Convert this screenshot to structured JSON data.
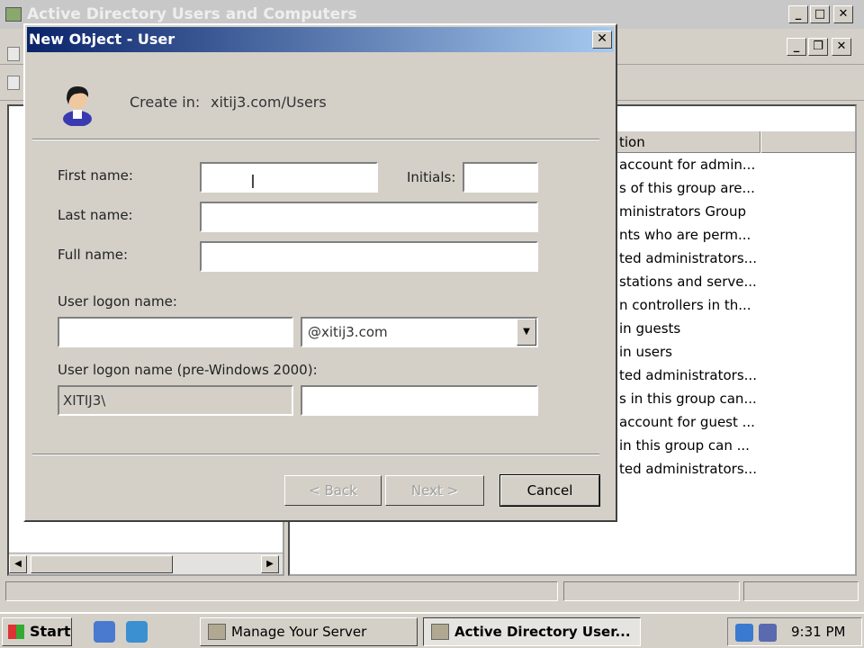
{
  "main_window": {
    "title": "Active Directory Users and Computers",
    "list": {
      "column_header": "tion",
      "rows": [
        "account for admin...",
        "s of this group are...",
        "ministrators Group",
        "nts who are perm...",
        "ted administrators...",
        "stations and serve...",
        "n controllers in th...",
        "in guests",
        "in users",
        "ted administrators...",
        "s in this group can...",
        "account for guest ...",
        "in this group can ...",
        "ted administrators..."
      ]
    }
  },
  "dialog": {
    "title": "New Object - User",
    "close_glyph": "✕",
    "create_in_label": "Create in:",
    "create_in_path": "xitij3.com/Users",
    "fields": {
      "first_name_label": "First name:",
      "first_name_value": "",
      "initials_label": "Initials:",
      "initials_value": "",
      "last_name_label": "Last name:",
      "last_name_value": "",
      "full_name_label": "Full name:",
      "full_name_value": "",
      "logon_label": "User logon name:",
      "logon_value": "",
      "domain_value": "@xitij3.com",
      "pre2000_label": "User logon name (pre-Windows 2000):",
      "pre2000_domain": "XITIJ3\\",
      "pre2000_value": ""
    },
    "buttons": {
      "back": "< Back",
      "next": "Next >",
      "cancel": "Cancel"
    }
  },
  "taskbar": {
    "start": "Start",
    "tasks": [
      {
        "label": "Manage Your Server",
        "active": false
      },
      {
        "label": "Active Directory User...",
        "active": true
      }
    ],
    "clock": "9:31 PM"
  },
  "colors": {
    "title_active_start": "#0a246a",
    "title_active_end": "#a6caf0",
    "face": "#d4d0c8"
  }
}
